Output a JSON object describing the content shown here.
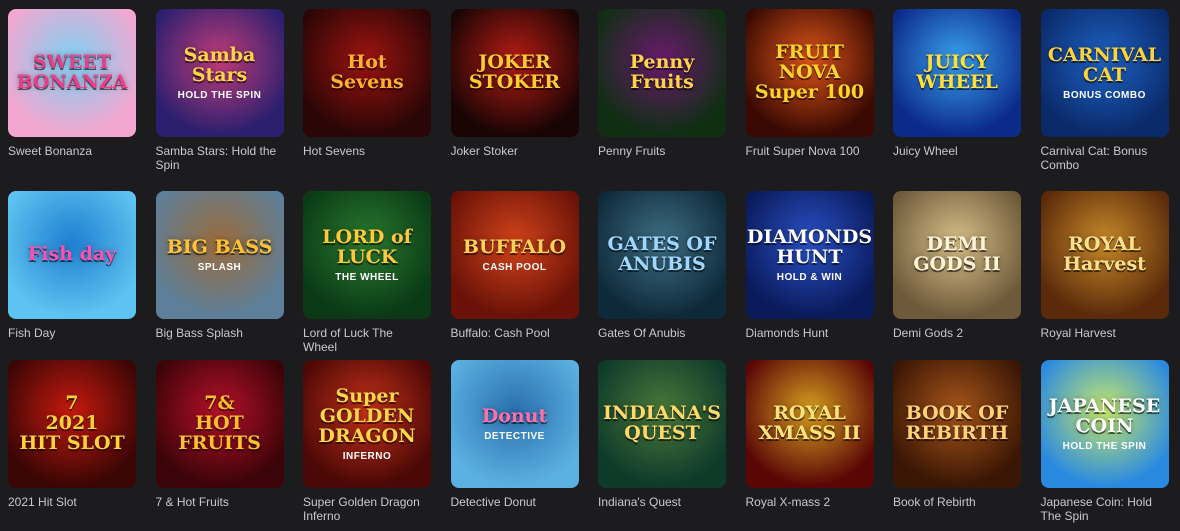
{
  "games": [
    {
      "title": "Sweet Bonanza",
      "art": "SWEET\nBONANZA",
      "sub": "",
      "bg": "#f3a7d0",
      "bg2": "#7fd0f2",
      "fg": "#e83e8c"
    },
    {
      "title": "Samba Stars: Hold the Spin",
      "art": "Samba\nStars",
      "sub": "HOLD THE SPIN",
      "bg": "#2b1f6e",
      "bg2": "#c23c7a",
      "fg": "#ffd447"
    },
    {
      "title": "Hot Sevens",
      "art": "Hot\nSevens",
      "sub": "",
      "bg": "#2a0606",
      "bg2": "#9e1410",
      "fg": "#ffb02e"
    },
    {
      "title": "Joker Stoker",
      "art": "JOKER STOKER",
      "sub": "",
      "bg": "#1a0505",
      "bg2": "#b81c14",
      "fg": "#ffcc33"
    },
    {
      "title": "Penny Fruits",
      "art": "Penny Fruits",
      "sub": "",
      "bg": "#0f2e12",
      "bg2": "#6b1a6e",
      "fg": "#ffd34a"
    },
    {
      "title": "Fruit Super Nova 100",
      "art": "FRUIT NOVA\nSuper 100",
      "sub": "",
      "bg": "#3a0a02",
      "bg2": "#e0561a",
      "fg": "#ffd42a"
    },
    {
      "title": "Juicy Wheel",
      "art": "JUICY\nWHEEL",
      "sub": "",
      "bg": "#0c2a8a",
      "bg2": "#3aa2f0",
      "fg": "#ffe03a"
    },
    {
      "title": "Carnival Cat: Bonus Combo",
      "art": "CARNIVAL CAT",
      "sub": "BONUS COMBO",
      "bg": "#0a2a6a",
      "bg2": "#1e63c4",
      "fg": "#ffd23a"
    },
    {
      "title": "Fish Day",
      "art": "Fish day",
      "sub": "",
      "bg": "#5ec3f0",
      "bg2": "#1f7fd1",
      "fg": "#ff4fb5"
    },
    {
      "title": "Big Bass Splash",
      "art": "BIG BASS",
      "sub": "SPLASH",
      "bg": "#5d7f9a",
      "bg2": "#9a6b3a",
      "fg": "#ffc233"
    },
    {
      "title": "Lord of Luck The Wheel",
      "art": "LORD of LUCK",
      "sub": "THE WHEEL",
      "bg": "#0a3a16",
      "bg2": "#2a7a2e",
      "fg": "#ffc93a"
    },
    {
      "title": "Buffalo: Cash Pool",
      "art": "BUFFALO",
      "sub": "CASH POOL",
      "bg": "#6a1208",
      "bg2": "#d2431a",
      "fg": "#ffd35a"
    },
    {
      "title": "Gates Of Anubis",
      "art": "GATES OF\nANUBIS",
      "sub": "",
      "bg": "#0e2a3a",
      "bg2": "#3f6f84",
      "fg": "#9fd8ff"
    },
    {
      "title": "Diamonds Hunt",
      "art": "DIAMONDS\nHUNT",
      "sub": "HOLD & WIN",
      "bg": "#0a1a5a",
      "bg2": "#2a52c8",
      "fg": "#ffffff"
    },
    {
      "title": "Demi Gods 2",
      "art": "DEMI GODS II",
      "sub": "",
      "bg": "#6e5a3a",
      "bg2": "#d8c08a",
      "fg": "#fff4d6"
    },
    {
      "title": "Royal Harvest",
      "art": "ROYAL\nHarvest",
      "sub": "",
      "bg": "#5a2a0a",
      "bg2": "#c88a2a",
      "fg": "#ffe08a"
    },
    {
      "title": "2021 Hit Slot",
      "art": "7\n2021\nHIT SLOT",
      "sub": "",
      "bg": "#3a0604",
      "bg2": "#c81a10",
      "fg": "#ffd23a"
    },
    {
      "title": "7 & Hot Fruits",
      "art": "7&\nHOT\nFRUITS",
      "sub": "",
      "bg": "#3a0408",
      "bg2": "#b8102a",
      "fg": "#ffc02a"
    },
    {
      "title": "Super Golden Dragon Inferno",
      "art": "Super\nGOLDEN\nDRAGON",
      "sub": "INFERNO",
      "bg": "#4a0806",
      "bg2": "#c8321a",
      "fg": "#ffd84a"
    },
    {
      "title": "Detective Donut",
      "art": "Donut",
      "sub": "DETECTIVE",
      "bg": "#5ab0e0",
      "bg2": "#2a6fae",
      "fg": "#ff6fb0"
    },
    {
      "title": "Indiana's Quest",
      "art": "INDIANA'S\nQUEST",
      "sub": "",
      "bg": "#0e3a2a",
      "bg2": "#4a7a3a",
      "fg": "#ffd86a"
    },
    {
      "title": "Royal X-mass 2",
      "art": "ROYAL XMASS II",
      "sub": "",
      "bg": "#5a0606",
      "bg2": "#d8a020",
      "fg": "#ffe27a"
    },
    {
      "title": "Book of Rebirth",
      "art": "BOOK OF REBIRTH",
      "sub": "",
      "bg": "#3a1604",
      "bg2": "#a8561a",
      "fg": "#ffd27a"
    },
    {
      "title": "Japanese Coin: Hold The Spin",
      "art": "JAPANESE\nCOIN",
      "sub": "HOLD THE SPIN",
      "bg": "#2a8ae0",
      "bg2": "#c8e86a",
      "fg": "#ffffff"
    }
  ]
}
